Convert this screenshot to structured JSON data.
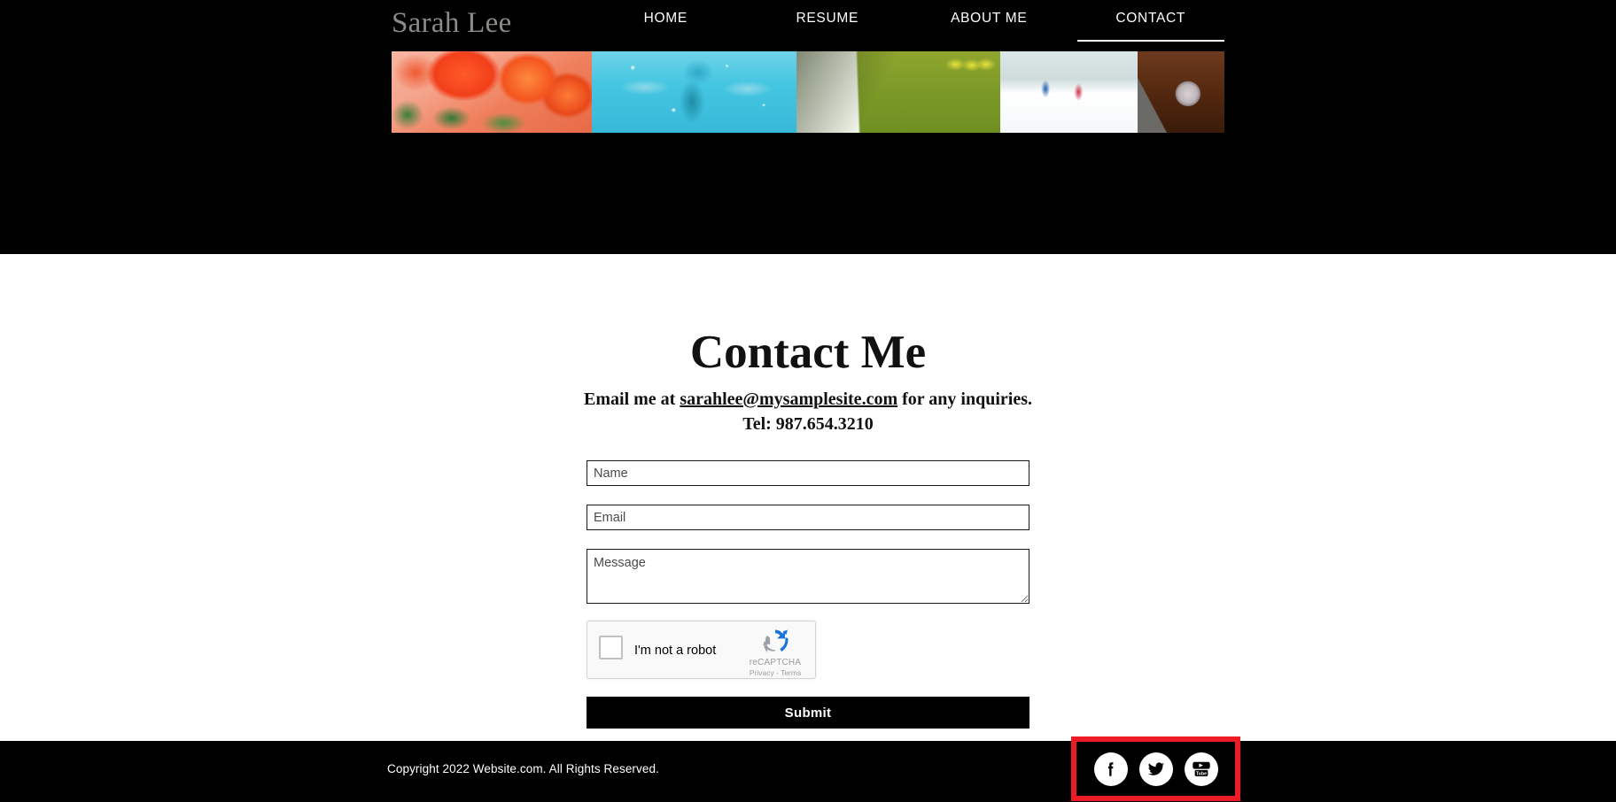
{
  "site": {
    "logo": "Sarah Lee"
  },
  "nav": {
    "items": [
      {
        "label": "HOME",
        "active": false
      },
      {
        "label": "RESUME",
        "active": false
      },
      {
        "label": "ABOUT ME",
        "active": false
      },
      {
        "label": "CONTACT",
        "active": true
      }
    ]
  },
  "banner": {
    "images": [
      {
        "name": "tulips-photo",
        "alt": "Close-up of orange and red tulips"
      },
      {
        "name": "swimming-photo",
        "alt": "Swimmer underwater in a blue pool"
      },
      {
        "name": "golf-photo",
        "alt": "Golfer shadow on a green with yellow balls"
      },
      {
        "name": "skiing-photo",
        "alt": "Two cross-country skiers in snowy forest"
      },
      {
        "name": "fly-fishing-photo",
        "alt": "Fly fishing reel with yellow line on wood"
      }
    ]
  },
  "main": {
    "title": "Contact Me",
    "intro_prefix": "Email me at ",
    "email": "sarahlee@mysamplesite.com",
    "intro_suffix": " for any inquiries.",
    "phone": "Tel: 987.654.3210"
  },
  "form": {
    "name_placeholder": "Name",
    "name_value": "",
    "email_placeholder": "Email",
    "email_value": "",
    "message_placeholder": "Message",
    "message_value": "",
    "submit_label": "Submit"
  },
  "recaptcha": {
    "checkbox_label": "I'm not a robot",
    "brand": "reCAPTCHA",
    "privacy": "Privacy",
    "separator": " - ",
    "terms": "Terms",
    "checked": false
  },
  "footer": {
    "copyright": "Copyright 2022 Website.com. All Rights Reserved.",
    "social": [
      {
        "name": "facebook-icon",
        "label": "Facebook"
      },
      {
        "name": "twitter-icon",
        "label": "Twitter"
      },
      {
        "name": "youtube-icon",
        "label": "YouTube"
      }
    ],
    "highlight_color": "#ed1c24"
  },
  "colors": {
    "hero_background": "#000000",
    "footer_background": "#000000",
    "page_background": "#ffffff",
    "logo_text": "#8c8a86",
    "nav_text": "#ffffff",
    "submit_background": "#000000",
    "highlight": "#ed1c24"
  }
}
